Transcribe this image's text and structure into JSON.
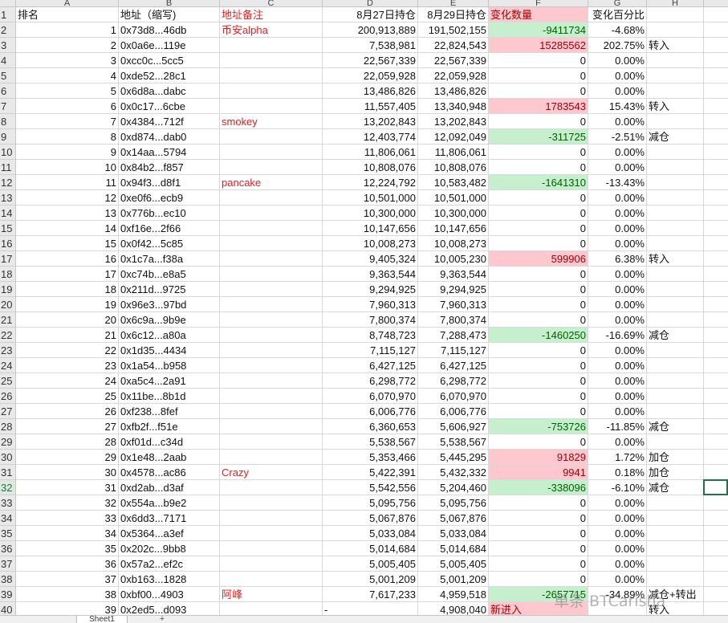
{
  "columns": [
    "A",
    "B",
    "C",
    "D",
    "E",
    "F",
    "G",
    "H"
  ],
  "header_row": {
    "num": "1",
    "rank": "排名",
    "address": "地址（缩写)",
    "note": "地址备注",
    "aug27": "8月27日持仓",
    "aug29": "8月29日持仓",
    "change": "变化数量",
    "pct": "变化百分比",
    "action": ""
  },
  "rows": [
    {
      "num": "2",
      "rank": "1",
      "address": "0x73d8...46db",
      "note": "币安alpha",
      "aug27": "200,913,889",
      "aug29": "191,502,155",
      "change": "-9411734",
      "pct": "-4.68%",
      "action": "",
      "fill": "green"
    },
    {
      "num": "3",
      "rank": "2",
      "address": "0x0a6e...119e",
      "note": "",
      "aug27": "7,538,981",
      "aug29": "22,824,543",
      "change": "15285562",
      "pct": "202.75%",
      "action": "转入",
      "fill": "red"
    },
    {
      "num": "4",
      "rank": "3",
      "address": "0xcc0c...5cc5",
      "note": "",
      "aug27": "22,567,339",
      "aug29": "22,567,339",
      "change": "0",
      "pct": "0.00%",
      "action": "",
      "fill": ""
    },
    {
      "num": "5",
      "rank": "4",
      "address": "0xde52...28c1",
      "note": "",
      "aug27": "22,059,928",
      "aug29": "22,059,928",
      "change": "0",
      "pct": "0.00%",
      "action": "",
      "fill": ""
    },
    {
      "num": "6",
      "rank": "5",
      "address": "0x6d8a...dabc",
      "note": "",
      "aug27": "13,486,826",
      "aug29": "13,486,826",
      "change": "0",
      "pct": "0.00%",
      "action": "",
      "fill": ""
    },
    {
      "num": "7",
      "rank": "6",
      "address": "0x0c17...6cbe",
      "note": "",
      "aug27": "11,557,405",
      "aug29": "13,340,948",
      "change": "1783543",
      "pct": "15.43%",
      "action": "转入",
      "fill": "red"
    },
    {
      "num": "8",
      "rank": "7",
      "address": "0x4384...712f",
      "note": "smokey",
      "aug27": "13,202,843",
      "aug29": "13,202,843",
      "change": "0",
      "pct": "0.00%",
      "action": "",
      "fill": ""
    },
    {
      "num": "9",
      "rank": "8",
      "address": "0xd874...dab0",
      "note": "",
      "aug27": "12,403,774",
      "aug29": "12,092,049",
      "change": "-311725",
      "pct": "-2.51%",
      "action": "减仓",
      "fill": "green"
    },
    {
      "num": "10",
      "rank": "9",
      "address": "0x14aa...5794",
      "note": "",
      "aug27": "11,806,061",
      "aug29": "11,806,061",
      "change": "0",
      "pct": "0.00%",
      "action": "",
      "fill": ""
    },
    {
      "num": "11",
      "rank": "10",
      "address": "0x84b2...f857",
      "note": "",
      "aug27": "10,808,076",
      "aug29": "10,808,076",
      "change": "0",
      "pct": "0.00%",
      "action": "",
      "fill": ""
    },
    {
      "num": "12",
      "rank": "11",
      "address": "0x94f3...d8f1",
      "note": "pancake",
      "aug27": "12,224,792",
      "aug29": "10,583,482",
      "change": "-1641310",
      "pct": "-13.43%",
      "action": "",
      "fill": "green"
    },
    {
      "num": "13",
      "rank": "12",
      "address": "0xe0f6...ecb9",
      "note": "",
      "aug27": "10,501,000",
      "aug29": "10,501,000",
      "change": "0",
      "pct": "0.00%",
      "action": "",
      "fill": ""
    },
    {
      "num": "14",
      "rank": "13",
      "address": "0x776b...ec10",
      "note": "",
      "aug27": "10,300,000",
      "aug29": "10,300,000",
      "change": "0",
      "pct": "0.00%",
      "action": "",
      "fill": ""
    },
    {
      "num": "15",
      "rank": "14",
      "address": "0xf16e...2f66",
      "note": "",
      "aug27": "10,147,656",
      "aug29": "10,147,656",
      "change": "0",
      "pct": "0.00%",
      "action": "",
      "fill": ""
    },
    {
      "num": "16",
      "rank": "15",
      "address": "0x0f42...5c85",
      "note": "",
      "aug27": "10,008,273",
      "aug29": "10,008,273",
      "change": "0",
      "pct": "0.00%",
      "action": "",
      "fill": ""
    },
    {
      "num": "17",
      "rank": "16",
      "address": "0x1c7a...f38a",
      "note": "",
      "aug27": "9,405,324",
      "aug29": "10,005,230",
      "change": "599906",
      "pct": "6.38%",
      "action": "转入",
      "fill": "red"
    },
    {
      "num": "18",
      "rank": "17",
      "address": "0xc74b...e8a5",
      "note": "",
      "aug27": "9,363,544",
      "aug29": "9,363,544",
      "change": "0",
      "pct": "0.00%",
      "action": "",
      "fill": ""
    },
    {
      "num": "19",
      "rank": "18",
      "address": "0x211d...9725",
      "note": "",
      "aug27": "9,294,925",
      "aug29": "9,294,925",
      "change": "0",
      "pct": "0.00%",
      "action": "",
      "fill": ""
    },
    {
      "num": "20",
      "rank": "19",
      "address": "0x96e3...97bd",
      "note": "",
      "aug27": "7,960,313",
      "aug29": "7,960,313",
      "change": "0",
      "pct": "0.00%",
      "action": "",
      "fill": ""
    },
    {
      "num": "21",
      "rank": "20",
      "address": "0x6c9a...9b9e",
      "note": "",
      "aug27": "7,800,374",
      "aug29": "7,800,374",
      "change": "0",
      "pct": "0.00%",
      "action": "",
      "fill": ""
    },
    {
      "num": "22",
      "rank": "21",
      "address": "0x6c12...a80a",
      "note": "",
      "aug27": "8,748,723",
      "aug29": "7,288,473",
      "change": "-1460250",
      "pct": "-16.69%",
      "action": "减仓",
      "fill": "green"
    },
    {
      "num": "23",
      "rank": "22",
      "address": "0x1d35...4434",
      "note": "",
      "aug27": "7,115,127",
      "aug29": "7,115,127",
      "change": "0",
      "pct": "0.00%",
      "action": "",
      "fill": ""
    },
    {
      "num": "24",
      "rank": "23",
      "address": "0x1a54...b958",
      "note": "",
      "aug27": "6,427,125",
      "aug29": "6,427,125",
      "change": "0",
      "pct": "0.00%",
      "action": "",
      "fill": ""
    },
    {
      "num": "25",
      "rank": "24",
      "address": "0xa5c4...2a91",
      "note": "",
      "aug27": "6,298,772",
      "aug29": "6,298,772",
      "change": "0",
      "pct": "0.00%",
      "action": "",
      "fill": ""
    },
    {
      "num": "26",
      "rank": "25",
      "address": "0x11be...8b1d",
      "note": "",
      "aug27": "6,070,970",
      "aug29": "6,070,970",
      "change": "0",
      "pct": "0.00%",
      "action": "",
      "fill": ""
    },
    {
      "num": "27",
      "rank": "26",
      "address": "0xf238...8fef",
      "note": "",
      "aug27": "6,006,776",
      "aug29": "6,006,776",
      "change": "0",
      "pct": "0.00%",
      "action": "",
      "fill": ""
    },
    {
      "num": "28",
      "rank": "27",
      "address": "0xfb2f...f51e",
      "note": "",
      "aug27": "6,360,653",
      "aug29": "5,606,927",
      "change": "-753726",
      "pct": "-11.85%",
      "action": "减仓",
      "fill": "green"
    },
    {
      "num": "29",
      "rank": "28",
      "address": "0xf01d...c34d",
      "note": "",
      "aug27": "5,538,567",
      "aug29": "5,538,567",
      "change": "0",
      "pct": "0.00%",
      "action": "",
      "fill": ""
    },
    {
      "num": "30",
      "rank": "29",
      "address": "0x1e48...2aab",
      "note": "",
      "aug27": "5,353,466",
      "aug29": "5,445,295",
      "change": "91829",
      "pct": "1.72%",
      "action": "加仓",
      "fill": "red"
    },
    {
      "num": "31",
      "rank": "30",
      "address": "0x4578...ac86",
      "note": "Crazy",
      "aug27": "5,422,391",
      "aug29": "5,432,332",
      "change": "9941",
      "pct": "0.18%",
      "action": "加仓",
      "fill": "red"
    },
    {
      "num": "32",
      "rank": "31",
      "address": "0xd2ab...d3af",
      "note": "",
      "aug27": "5,542,556",
      "aug29": "5,204,460",
      "change": "-338096",
      "pct": "-6.10%",
      "action": "减仓",
      "fill": "green"
    },
    {
      "num": "33",
      "rank": "32",
      "address": "0x554a...b9e2",
      "note": "",
      "aug27": "5,095,756",
      "aug29": "5,095,756",
      "change": "0",
      "pct": "0.00%",
      "action": "",
      "fill": ""
    },
    {
      "num": "34",
      "rank": "33",
      "address": "0x6dd3...7171",
      "note": "",
      "aug27": "5,067,876",
      "aug29": "5,067,876",
      "change": "0",
      "pct": "0.00%",
      "action": "",
      "fill": ""
    },
    {
      "num": "35",
      "rank": "34",
      "address": "0x5364...a3ef",
      "note": "",
      "aug27": "5,033,084",
      "aug29": "5,033,084",
      "change": "0",
      "pct": "0.00%",
      "action": "",
      "fill": ""
    },
    {
      "num": "36",
      "rank": "35",
      "address": "0x202c...9bb8",
      "note": "",
      "aug27": "5,014,684",
      "aug29": "5,014,684",
      "change": "0",
      "pct": "0.00%",
      "action": "",
      "fill": ""
    },
    {
      "num": "37",
      "rank": "36",
      "address": "0x57a2...ef2c",
      "note": "",
      "aug27": "5,005,405",
      "aug29": "5,005,405",
      "change": "0",
      "pct": "0.00%",
      "action": "",
      "fill": ""
    },
    {
      "num": "38",
      "rank": "37",
      "address": "0xb163...1828",
      "note": "",
      "aug27": "5,001,209",
      "aug29": "5,001,209",
      "change": "0",
      "pct": "0.00%",
      "action": "",
      "fill": ""
    },
    {
      "num": "39",
      "rank": "38",
      "address": "0xbf00...4903",
      "note": "阿峰",
      "aug27": "7,617,233",
      "aug29": "4,959,518",
      "change": "-2657715",
      "pct": "-34.89%",
      "action": "减仓+转出",
      "fill": "green"
    },
    {
      "num": "40",
      "rank": "39",
      "address": "0x2ed5...d093",
      "note": "",
      "aug27": "-",
      "aug29": "4,908,040",
      "change": "新进入",
      "pct": "",
      "action": "转入",
      "fill": "red"
    }
  ],
  "sheet_tab": "Sheet1",
  "add_sheet": "+",
  "watermark": "单条 BTCarisha",
  "colors": {
    "red_fill": "#ffc7ce",
    "green_fill": "#c6efce",
    "note_red": "#e02020",
    "selection": "#217346"
  },
  "selected_row": "32"
}
